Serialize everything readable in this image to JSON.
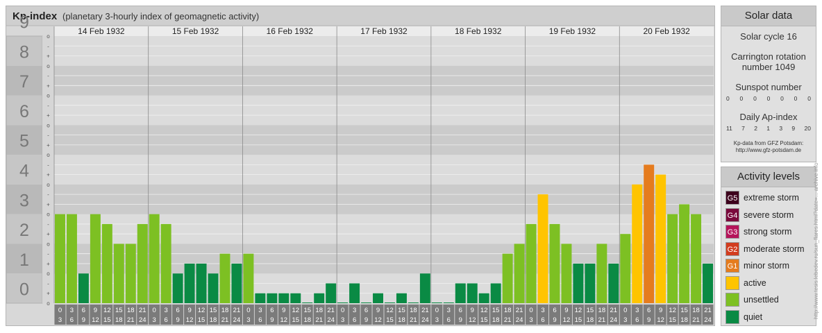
{
  "header": {
    "title": "Kp-index",
    "subtitle": "(planetary 3-hourly index of geomagnetic activity)"
  },
  "colors": {
    "quiet": "#0a8a44",
    "unsettled": "#7dc023",
    "active": "#ffc400",
    "g1": "#e57c1e",
    "g2": "#d23c1e",
    "g3": "#b5145a",
    "g4": "#7a0a3c",
    "g5": "#3d001c"
  },
  "chart_data": {
    "type": "bar",
    "ylim": [
      0,
      9
    ],
    "y_ticks": [
      "0",
      "1",
      "2",
      "3",
      "4",
      "5",
      "6",
      "7",
      "8",
      "9"
    ],
    "y_subticks": [
      "o",
      "+",
      "-"
    ],
    "days": [
      "14 Feb 1932",
      "15 Feb 1932",
      "16 Feb 1932",
      "17 Feb 1932",
      "18 Feb 1932",
      "19 Feb 1932",
      "20 Feb 1932"
    ],
    "hour_bins": [
      [
        "0",
        "3"
      ],
      [
        "3",
        "6"
      ],
      [
        "6",
        "9"
      ],
      [
        "9",
        "12"
      ],
      [
        "12",
        "15"
      ],
      [
        "15",
        "18"
      ],
      [
        "18",
        "21"
      ],
      [
        "21",
        "24"
      ]
    ],
    "values": [
      [
        3.0,
        3.0,
        1.0,
        3.0,
        2.667,
        2.0,
        2.0,
        2.667
      ],
      [
        3.0,
        2.667,
        1.0,
        1.333,
        1.333,
        1.0,
        1.667,
        1.333
      ],
      [
        1.667,
        0.333,
        0.333,
        0.333,
        0.333,
        0.0,
        0.333,
        0.667
      ],
      [
        0.0,
        0.667,
        0.0,
        0.333,
        0.0,
        0.333,
        0.0,
        1.0
      ],
      [
        0.0,
        0.0,
        0.667,
        0.667,
        0.333,
        0.667,
        1.667,
        2.0
      ],
      [
        2.667,
        3.667,
        2.667,
        2.0,
        1.333,
        1.333,
        2.0,
        1.333
      ],
      [
        2.333,
        4.0,
        4.667,
        4.333,
        3.0,
        3.333,
        3.0,
        1.333
      ]
    ]
  },
  "solar": {
    "title": "Solar data",
    "cycle": "Solar cycle 16",
    "carrington_line1": "Carrington rotation",
    "carrington_line2": "number 1049",
    "sunspot_title": "Sunspot number",
    "sunspot_values": [
      "0",
      "0",
      "0",
      "0",
      "0",
      "0",
      "0"
    ],
    "ap_title": "Daily Ap-index",
    "ap_values": [
      "11",
      "7",
      "2",
      "1",
      "3",
      "9",
      "20"
    ],
    "credit_line1": "Kp-data from GFZ Potsdam:",
    "credit_line2": "http://www.gfz-potsdam.de"
  },
  "activity": {
    "title": "Activity levels",
    "items": [
      {
        "code": "G5",
        "label": "extreme storm",
        "color": "#3d001c"
      },
      {
        "code": "G4",
        "label": "severe storm",
        "color": "#7a0a3c"
      },
      {
        "code": "G3",
        "label": "strong storm",
        "color": "#b5145a"
      },
      {
        "code": "G2",
        "label": "moderate storm",
        "color": "#d23c1e"
      },
      {
        "code": "G1",
        "label": "minor storm",
        "color": "#e57c1e"
      },
      {
        "code": "",
        "label": "active",
        "color": "#ffc400"
      },
      {
        "code": "",
        "label": "unsettled",
        "color": "#7dc023"
      },
      {
        "code": "",
        "label": "quiet",
        "color": "#0a8a44"
      }
    ]
  },
  "watermark": "http://www.tesis.lebedev.ru/sun_flares.html?date=... archive info"
}
